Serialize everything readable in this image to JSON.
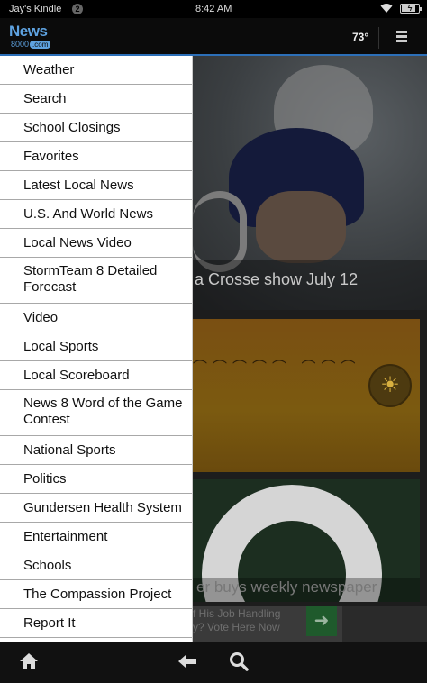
{
  "status_bar": {
    "device_name": "Jay's Kindle",
    "notification_count": "2",
    "time": "8:42 AM",
    "battery_level": 0.8
  },
  "header": {
    "logo_main": "News",
    "logo_sub": "8000",
    "logo_dot": ".com",
    "temperature": "73°"
  },
  "drawer": {
    "items": [
      "Weather",
      "Search",
      "School Closings",
      "Favorites",
      "Latest Local News",
      "U.S. And World News",
      "Local News Video",
      "StormTeam 8 Detailed Forecast",
      "Video",
      "Local Sports",
      "Local Scoreboard",
      "News 8 Word of the Game Contest",
      "National Sports",
      "Politics",
      "Gundersen Health System",
      "Entertainment",
      "Schools",
      "The Compassion Project",
      "Report It"
    ]
  },
  "content": {
    "hero_caption": "a Crosse show July 12",
    "packers_caption": "er buys weekly newspaper",
    "ad_line1": "f His Job Handling",
    "ad_line2": "y? Vote Here Now"
  },
  "colors": {
    "accent": "#2c6fb8",
    "drawer_bg": "#ffffff"
  },
  "icons": {
    "home": "home-icon",
    "back": "back-arrow-icon",
    "search": "search-icon",
    "menu": "menu-icon",
    "wifi": "wifi-icon",
    "battery": "battery-icon",
    "weather": "sun-icon",
    "ad_action": "arrow-right-icon"
  }
}
